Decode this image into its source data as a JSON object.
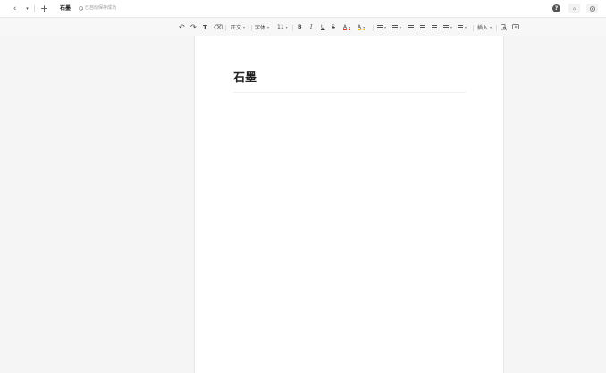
{
  "topbar": {
    "back_icon": "chevron-left-icon",
    "back_glyph": "‹",
    "history_icon": "caret-down-icon",
    "history_glyph": "▾",
    "new_icon": "plus-icon",
    "new_glyph": "+",
    "doc_title": "石墨",
    "saved_status": "已自动保存成功",
    "help_label": "?",
    "share_label": "⌂"
  },
  "toolbar": {
    "undo": "↶",
    "redo": "↷",
    "format_painter": "T",
    "clear_format": "⌫",
    "style_label": "正文",
    "font_label": "字体",
    "size_label": "11",
    "bold": "B",
    "italic": "I",
    "underline": "U",
    "strike": "S",
    "text_color": "A",
    "highlight": "A",
    "insert_label": "插入",
    "caret": "▾"
  },
  "document": {
    "heading": "石墨"
  },
  "colors": {
    "background": "#f5f5f5",
    "page": "#ffffff",
    "text_color_bar": "#e53935",
    "highlight_bar": "#f5c518"
  }
}
